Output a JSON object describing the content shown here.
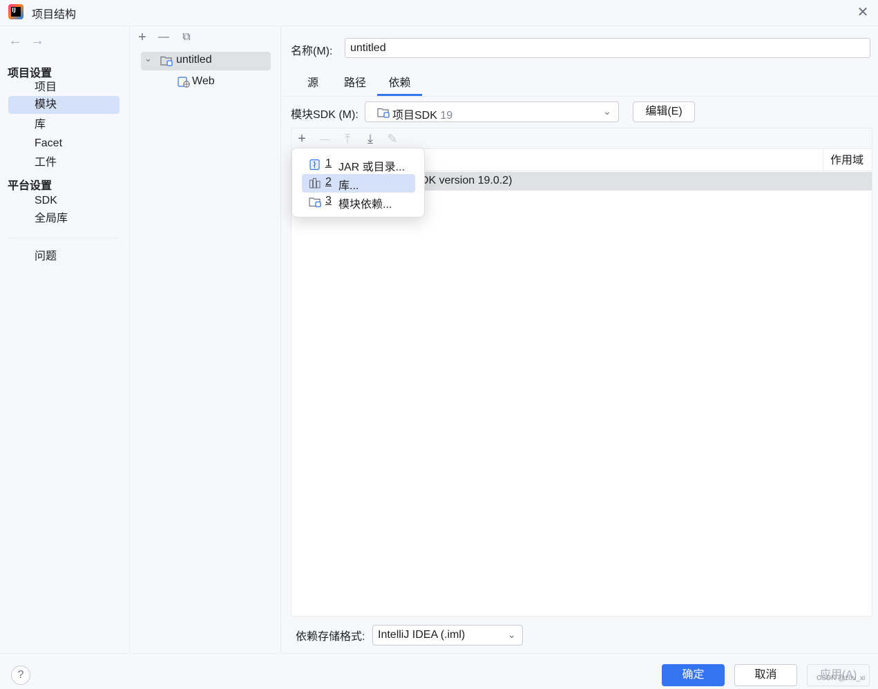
{
  "window": {
    "title": "项目结构",
    "close_glyph": "✕"
  },
  "nav": {
    "back_glyph": "←",
    "forward_glyph": "→",
    "section_project": "项目设置",
    "items_project": [
      "项目",
      "模块",
      "库",
      "Facet",
      "工件"
    ],
    "selected": "模块",
    "section_platform": "平台设置",
    "items_platform": [
      "SDK",
      "全局库"
    ],
    "problems": "问题"
  },
  "tree": {
    "toolbar": {
      "add": "+",
      "remove": "—",
      "copy": "⧉"
    },
    "root": {
      "label": "untitled",
      "expanded": true
    },
    "child": {
      "label": "Web"
    }
  },
  "module": {
    "name_label": "名称(M):",
    "name_value": "untitled",
    "tabs": [
      "源",
      "路径",
      "依赖"
    ],
    "active_tab": "依赖",
    "sdk_label": "模块SDK (M):",
    "sdk_value": "项目SDK",
    "sdk_version": "19",
    "edit_button": "编辑(E)",
    "dep_toolbar": {
      "add": "+",
      "remove": "—",
      "up": "⤒",
      "down": "⤓",
      "edit": "✎"
    },
    "scope_header": "作用域",
    "dep_row_text": "nJDK version 19.0.2)",
    "storage_label": "依赖存储格式:",
    "storage_value": "IntelliJ IDEA (.iml)"
  },
  "popup": {
    "items": [
      {
        "num": "1",
        "label": "JAR 或目录...",
        "icon": "jar-icon"
      },
      {
        "num": "2",
        "label": "库...",
        "icon": "library-icon"
      },
      {
        "num": "3",
        "label": "模块依赖...",
        "icon": "module-icon"
      }
    ],
    "selected_index": 1
  },
  "footer": {
    "help": "?",
    "ok": "确定",
    "cancel": "取消",
    "apply": "应用(A)",
    "watermark": "CSDN @zou_xi"
  },
  "colors": {
    "accent": "#3574f0",
    "selection": "#d5e1f8",
    "row_highlight": "#dfe1e5"
  }
}
